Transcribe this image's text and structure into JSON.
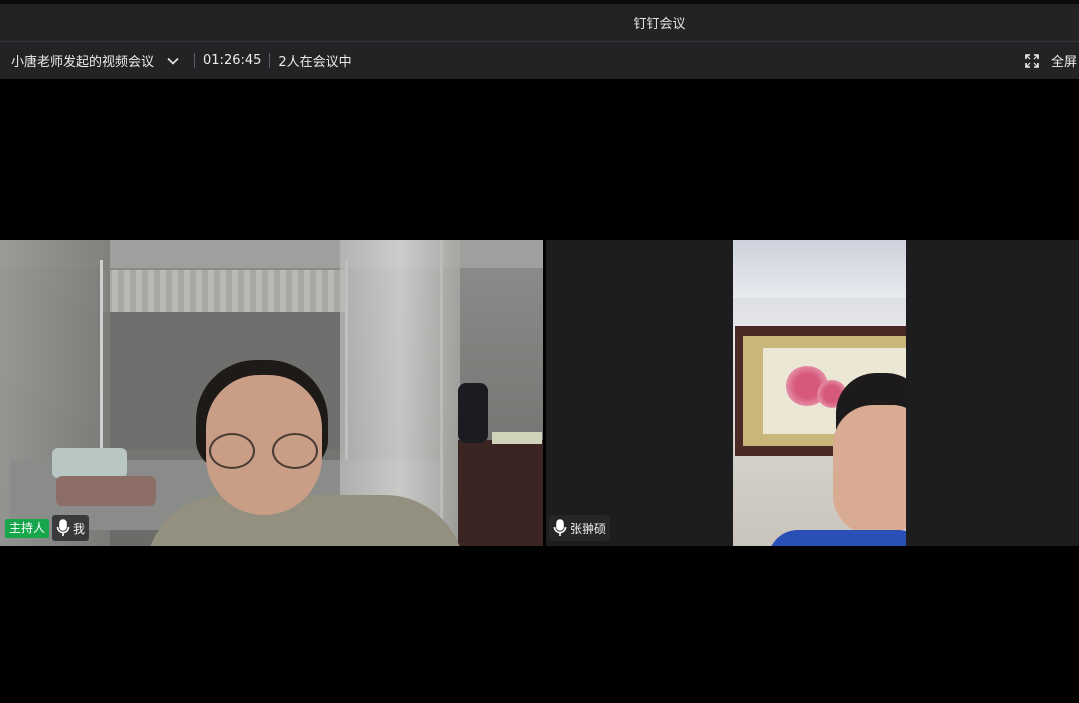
{
  "window": {
    "title": "钉钉会议"
  },
  "meeting": {
    "name": "小唐老师发起的视频会议",
    "duration": "01:26:45",
    "participants": "2人在会议中",
    "fullscreen_label": "全屏"
  },
  "tiles": [
    {
      "host_tag": "主持人",
      "name": "我",
      "mic": "mic-on"
    },
    {
      "name": "张翀硕",
      "mic": "mic-on"
    }
  ],
  "colors": {
    "bar_bg": "#232325",
    "host_green": "#17a64c",
    "stage_bg": "#000000"
  }
}
